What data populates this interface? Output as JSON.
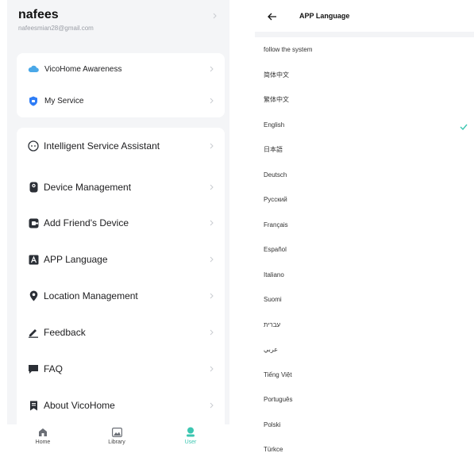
{
  "profile": {
    "name": "nafees",
    "email": "nafeesmian28@gmail.com"
  },
  "card1": [
    {
      "label": "VicoHome Awareness",
      "icon": "cloud-icon"
    },
    {
      "label": "My Service",
      "icon": "shield-icon"
    }
  ],
  "card2": [
    {
      "label": "Intelligent Service Assistant",
      "icon": "assistant-icon"
    },
    {
      "label": "Device Management",
      "icon": "camera-device-icon"
    },
    {
      "label": "Add Friend's Device",
      "icon": "add-device-icon"
    },
    {
      "label": "APP Language",
      "icon": "language-icon"
    },
    {
      "label": "Location Management",
      "icon": "location-pin-icon"
    },
    {
      "label": "Feedback",
      "icon": "pencil-icon"
    },
    {
      "label": "FAQ",
      "icon": "chat-bubble-icon"
    },
    {
      "label": "About VicoHome",
      "icon": "bookmark-icon"
    }
  ],
  "tabs": [
    {
      "label": "Home",
      "icon": "home-icon"
    },
    {
      "label": "Library",
      "icon": "image-icon"
    },
    {
      "label": "User",
      "icon": "user-icon",
      "active": true
    }
  ],
  "language_screen": {
    "title": "APP Language",
    "selected": "English",
    "options": [
      "follow the system",
      "简体中文",
      "繁体中文",
      "English",
      "日本語",
      "Deutsch",
      "Русский",
      "Français",
      "Español",
      "Italiano",
      "Suomi",
      "עברית",
      "عربي",
      "Tiếng Việt",
      "Português",
      "Polski",
      "Türkce"
    ]
  },
  "colors": {
    "accent": "#3cc6b1",
    "icon_dark": "#2b2f36",
    "service_blue": "#2f7df6",
    "cloud_blue": "#4aa8e8",
    "check_green": "#3cc6b1"
  }
}
